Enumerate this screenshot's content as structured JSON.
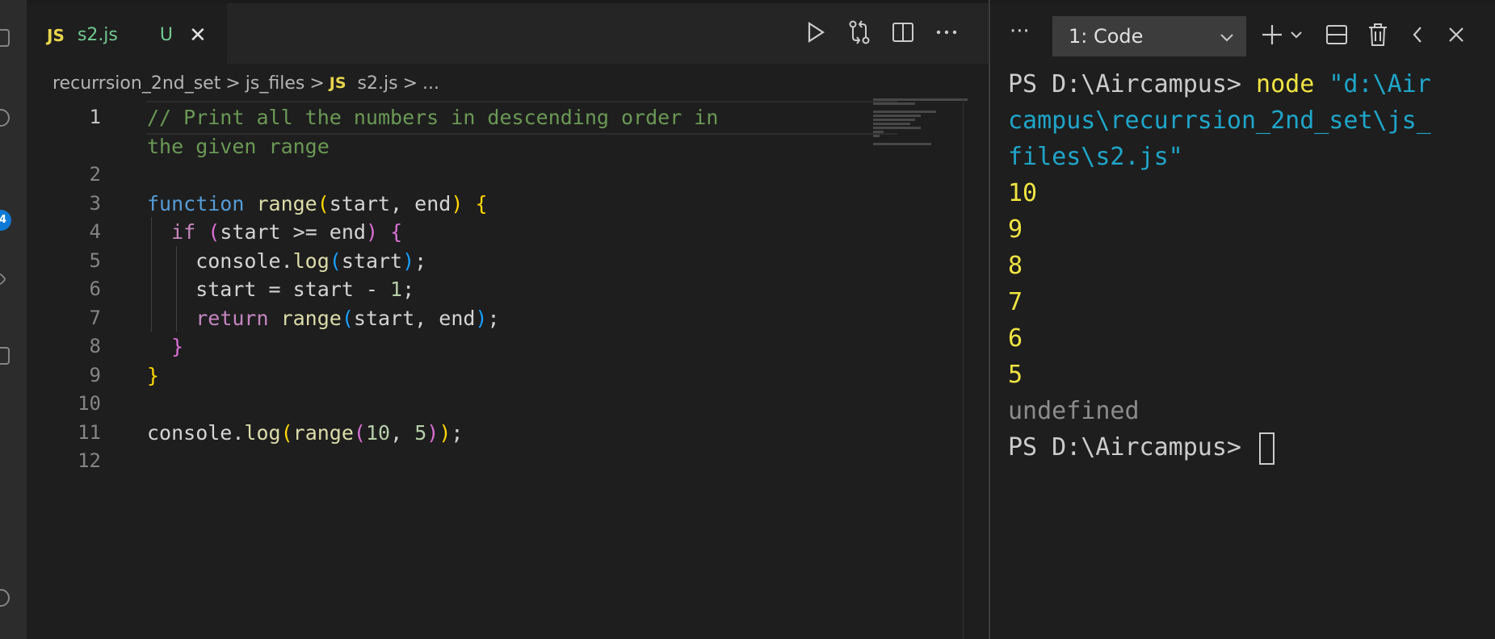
{
  "editor": {
    "tab": {
      "badge": "JS",
      "filename": "s2.js",
      "status": "U",
      "close": "✕"
    },
    "breadcrumb": [
      "recurrsion_2nd_set",
      "js_files",
      "s2.js",
      "..."
    ],
    "breadcrumb_badge": "JS",
    "breadcrumb_sep": ">",
    "lines": [
      {
        "num": "1",
        "tokens": [
          {
            "t": "// Print all the numbers in descending order in",
            "c": "tok-comment"
          }
        ]
      },
      {
        "num": "",
        "tokens": [
          {
            "t": "the given range",
            "c": "tok-comment"
          }
        ]
      },
      {
        "num": "2",
        "tokens": []
      },
      {
        "num": "3",
        "tokens": [
          {
            "t": "function",
            "c": "tok-keyword"
          },
          {
            "t": " range",
            "c": "tok-fn"
          },
          {
            "t": "(",
            "c": "b1"
          },
          {
            "t": "start, end",
            "c": "tok-var"
          },
          {
            "t": ")",
            "c": "b1"
          },
          {
            "t": " ",
            "c": "tok-var"
          },
          {
            "t": "{",
            "c": "b1"
          }
        ]
      },
      {
        "num": "4",
        "tokens": [
          {
            "t": "  ",
            "c": "tok-var"
          },
          {
            "t": "if",
            "c": "tok-control"
          },
          {
            "t": " ",
            "c": "tok-var"
          },
          {
            "t": "(",
            "c": "b2"
          },
          {
            "t": "start >= end",
            "c": "tok-var"
          },
          {
            "t": ")",
            "c": "b2"
          },
          {
            "t": " ",
            "c": "tok-var"
          },
          {
            "t": "{",
            "c": "b2"
          }
        ]
      },
      {
        "num": "5",
        "tokens": [
          {
            "t": "    console.",
            "c": "tok-var"
          },
          {
            "t": "log",
            "c": "tok-fn"
          },
          {
            "t": "(",
            "c": "b3"
          },
          {
            "t": "start",
            "c": "tok-var"
          },
          {
            "t": ")",
            "c": "b3"
          },
          {
            "t": ";",
            "c": "tok-var"
          }
        ]
      },
      {
        "num": "6",
        "tokens": [
          {
            "t": "    start = start - ",
            "c": "tok-var"
          },
          {
            "t": "1",
            "c": "tok-num"
          },
          {
            "t": ";",
            "c": "tok-var"
          }
        ]
      },
      {
        "num": "7",
        "tokens": [
          {
            "t": "    ",
            "c": "tok-var"
          },
          {
            "t": "return",
            "c": "tok-control"
          },
          {
            "t": " range",
            "c": "tok-fn"
          },
          {
            "t": "(",
            "c": "b3"
          },
          {
            "t": "start, end",
            "c": "tok-var"
          },
          {
            "t": ")",
            "c": "b3"
          },
          {
            "t": ";",
            "c": "tok-var"
          }
        ]
      },
      {
        "num": "8",
        "tokens": [
          {
            "t": "  ",
            "c": "tok-var"
          },
          {
            "t": "}",
            "c": "b2"
          }
        ]
      },
      {
        "num": "9",
        "tokens": [
          {
            "t": "}",
            "c": "b1"
          }
        ]
      },
      {
        "num": "10",
        "tokens": []
      },
      {
        "num": "11",
        "tokens": [
          {
            "t": "console.",
            "c": "tok-var"
          },
          {
            "t": "log",
            "c": "tok-fn"
          },
          {
            "t": "(",
            "c": "b1"
          },
          {
            "t": "range",
            "c": "tok-fn"
          },
          {
            "t": "(",
            "c": "b2"
          },
          {
            "t": "10",
            "c": "tok-num"
          },
          {
            "t": ", ",
            "c": "tok-var"
          },
          {
            "t": "5",
            "c": "tok-num"
          },
          {
            "t": ")",
            "c": "b2"
          },
          {
            "t": ")",
            "c": "b1"
          },
          {
            "t": ";",
            "c": "tok-var"
          }
        ]
      },
      {
        "num": "12",
        "tokens": []
      }
    ],
    "icons": [
      "run-icon",
      "compare-changes-icon",
      "split-editor-icon",
      "more-actions-icon"
    ]
  },
  "terminal": {
    "more": "···",
    "selected_terminal": "1: Code",
    "icons": [
      "plus-icon",
      "chevron-down-icon",
      "split-terminal-icon",
      "trash-icon",
      "chevron-left-icon",
      "close-icon"
    ],
    "lines": [
      {
        "parts": [
          {
            "t": "PS D:\\Aircampus> ",
            "c": "t-prompt"
          },
          {
            "t": "node",
            "c": "t-cmd"
          },
          {
            "t": " \"d:\\Air",
            "c": "t-arg"
          }
        ]
      },
      {
        "parts": [
          {
            "t": "campus\\recurrsion_2nd_set\\js_",
            "c": "t-arg"
          }
        ]
      },
      {
        "parts": [
          {
            "t": "files\\s2.js\"",
            "c": "t-arg"
          }
        ]
      },
      {
        "parts": [
          {
            "t": "10",
            "c": "t-out"
          }
        ]
      },
      {
        "parts": [
          {
            "t": "9",
            "c": "t-out"
          }
        ]
      },
      {
        "parts": [
          {
            "t": "8",
            "c": "t-out"
          }
        ]
      },
      {
        "parts": [
          {
            "t": "7",
            "c": "t-out"
          }
        ]
      },
      {
        "parts": [
          {
            "t": "6",
            "c": "t-out"
          }
        ]
      },
      {
        "parts": [
          {
            "t": "5",
            "c": "t-out"
          }
        ]
      },
      {
        "parts": [
          {
            "t": "undefined",
            "c": "t-undef"
          }
        ]
      },
      {
        "parts": [
          {
            "t": "PS D:\\Aircampus> ",
            "c": "t-prompt"
          }
        ],
        "cursor": true
      }
    ]
  },
  "activity": {
    "badge_count": "4"
  },
  "colors": {
    "accent": "#0e7ad6",
    "js_badge": "#e8d44d",
    "untracked": "#73c991"
  }
}
